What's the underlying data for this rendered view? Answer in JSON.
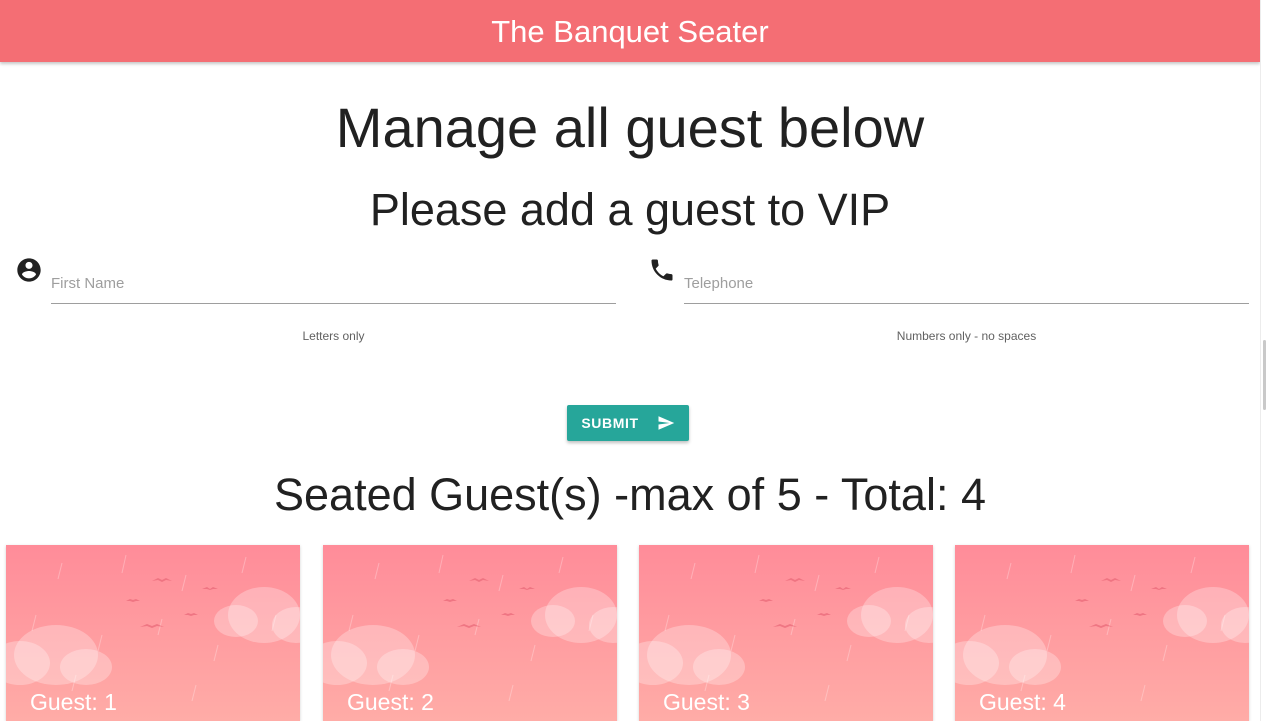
{
  "app": {
    "title": "The Banquet Seater",
    "brand_color": "#f46e74"
  },
  "main": {
    "heading": "Manage all guest below",
    "subheading": "Please add a guest to VIP",
    "seated_heading": "Seated Guest(s) -max of 5 - Total: 4"
  },
  "form": {
    "first_name": {
      "placeholder": "First Name",
      "value": "",
      "helper": "Letters only",
      "icon": "account-circle-icon"
    },
    "telephone": {
      "placeholder": "Telephone",
      "value": "",
      "helper": "Numbers only - no spaces",
      "icon": "phone-icon"
    },
    "submit": {
      "label": "SUBMIT",
      "icon": "send-icon",
      "color": "#26a69a"
    }
  },
  "guests": [
    {
      "title": "Guest: 1"
    },
    {
      "title": "Guest: 2"
    },
    {
      "title": "Guest: 3"
    },
    {
      "title": "Guest: 4"
    }
  ],
  "card_colors": {
    "top": "#ff8c99",
    "bottom": "#ffaca7"
  }
}
